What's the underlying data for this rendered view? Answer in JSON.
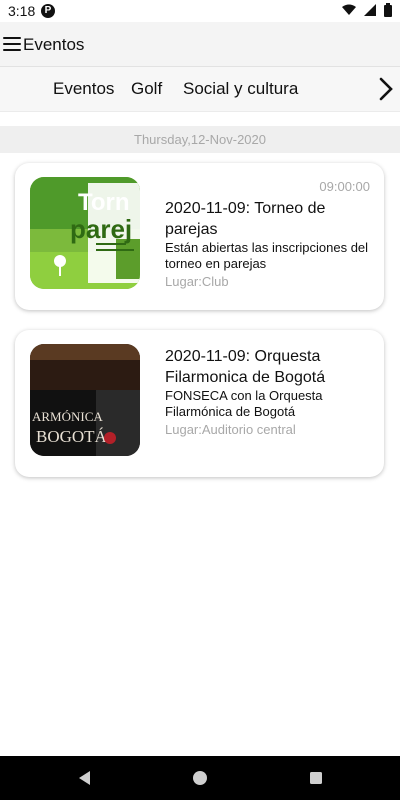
{
  "status_bar": {
    "time": "3:18",
    "notification_letter": "P"
  },
  "app_bar": {
    "title": "Eventos"
  },
  "tabs": [
    {
      "label": "Eventos"
    },
    {
      "label": "Golf"
    },
    {
      "label": "Social y cultura"
    }
  ],
  "date_header": "Thursday,12-Nov-2020",
  "events": [
    {
      "time": "09:00:00",
      "title": "2020-11-09: Torneo de parejas",
      "description": "Están abiertas las inscripciones del torneo en parejas",
      "place": "Lugar:Club",
      "image_text": "Torneo parejas"
    },
    {
      "time": "",
      "title": "2020-11-09: Orquesta Filarmonica de Bogotá",
      "description": "FONSECA con la Orquesta Filarmónica de Bogotá",
      "place": "Lugar:Auditorio central",
      "image_text": "ARMÓNICA BOGOTÁ"
    }
  ],
  "colors": {
    "app_bar_bg": "#f4f4f4",
    "muted_text": "#a8a8a8",
    "nav_bar_bg": "#000000"
  }
}
